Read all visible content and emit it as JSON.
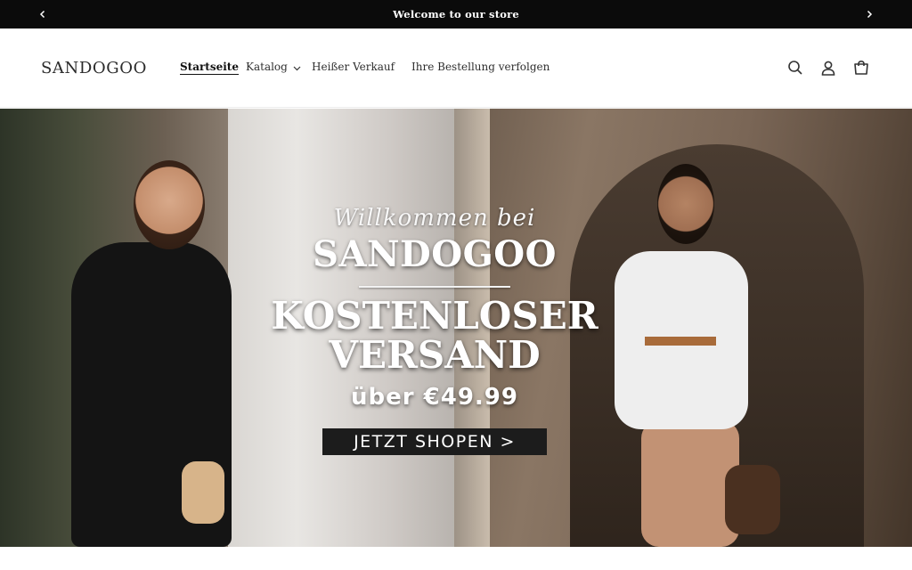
{
  "announcement": {
    "message": "Welcome to our store",
    "prev_icon": "chevron-left-icon",
    "next_icon": "chevron-right-icon"
  },
  "header": {
    "logo": "SANDOGOO",
    "nav": [
      {
        "label": "Startseite",
        "active": true
      },
      {
        "label": "Katalog",
        "dropdown": true
      },
      {
        "label": "Heißer Verkauf"
      },
      {
        "label": "Ihre Bestellung verfolgen"
      }
    ],
    "icons": [
      "search-icon",
      "account-icon",
      "cart-icon"
    ]
  },
  "hero": {
    "script_line": "Willkommen bei",
    "brand": "SANDOGOO",
    "headline_1": "KOSTENLOSER",
    "headline_2": "VERSAND",
    "subline": "über €49.99",
    "cta": "JETZT SHOPEN >"
  },
  "colors": {
    "announcement_bg": "#0b0b0b",
    "header_bg": "#ffffff",
    "cta_bg": "#1c1c1c",
    "text": "#2f2f2f"
  }
}
